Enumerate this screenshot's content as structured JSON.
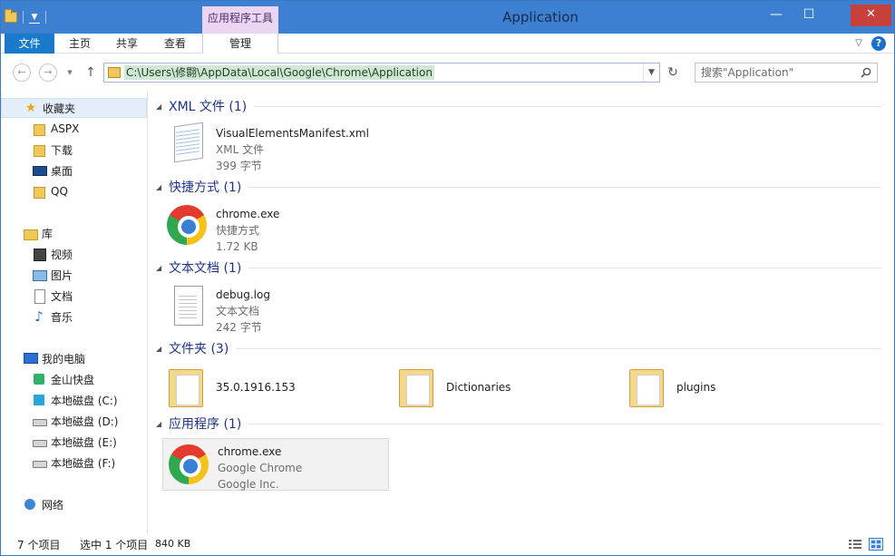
{
  "window": {
    "title": "Application",
    "context_tab_header": "应用程序工具",
    "close_glyph": "✕",
    "minimize_glyph": "—",
    "maximize_glyph": "☐"
  },
  "ribbon": {
    "tabs": [
      {
        "label": "文件"
      },
      {
        "label": "主页"
      },
      {
        "label": "共享"
      },
      {
        "label": "查看"
      },
      {
        "label": "管理"
      }
    ],
    "help_glyph": "?"
  },
  "address": {
    "path": "C:\\Users\\修翾\\AppData\\Local\\Google\\Chrome\\Application",
    "search_placeholder": "搜索\"Application\""
  },
  "nav_pane": {
    "favorites": {
      "label": "收藏夹",
      "items": [
        "ASPX",
        "下载",
        "桌面",
        "QQ"
      ]
    },
    "libraries": {
      "label": "库",
      "items": [
        "视频",
        "图片",
        "文档",
        "音乐"
      ]
    },
    "computer": {
      "label": "我的电脑",
      "items": [
        "金山快盘",
        "本地磁盘 (C:)",
        "本地磁盘 (D:)",
        "本地磁盘 (E:)",
        "本地磁盘 (F:)"
      ]
    },
    "network": {
      "label": "网络"
    }
  },
  "content": {
    "groups": [
      {
        "header": "XML 文件 (1)",
        "items": [
          {
            "name": "VisualElementsManifest.xml",
            "type": "XML 文件",
            "detail": "399 字节",
            "icon": "xml-file-icon"
          }
        ]
      },
      {
        "header": "快捷方式 (1)",
        "items": [
          {
            "name": "chrome.exe",
            "type": "快捷方式",
            "detail": "1.72 KB",
            "icon": "chrome-icon"
          }
        ]
      },
      {
        "header": "文本文档 (1)",
        "items": [
          {
            "name": "debug.log",
            "type": "文本文档",
            "detail": "242 字节",
            "icon": "text-file-icon"
          }
        ]
      },
      {
        "header": "文件夹 (3)",
        "items": [
          {
            "name": "35.0.1916.153",
            "icon": "folder-icon"
          },
          {
            "name": "Dictionaries",
            "icon": "folder-icon"
          },
          {
            "name": "plugins",
            "icon": "folder-icon"
          }
        ]
      },
      {
        "header": "应用程序 (1)",
        "items": [
          {
            "name": "chrome.exe",
            "type": "Google Chrome",
            "detail": "Google Inc.",
            "icon": "chrome-icon",
            "selected": true
          }
        ]
      }
    ]
  },
  "status": {
    "item_count": "7 个项目",
    "selected": "选中 1 个项目",
    "size": "840 KB"
  },
  "colors": {
    "title_bar": "#3d7fd0",
    "file_tab": "#1979ca",
    "context_tab": "#ead6f2",
    "group_header": "#1e3287",
    "close_button": "#c7413a"
  }
}
